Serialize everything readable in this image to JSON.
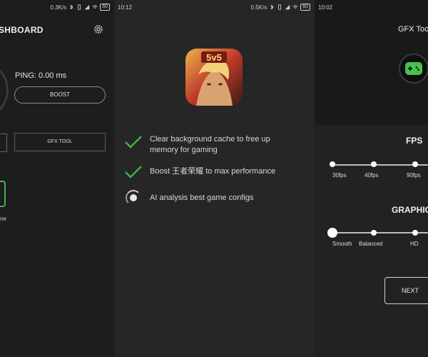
{
  "colors": {
    "accent_green": "#3fb24a",
    "background": "#1c1c1c"
  },
  "panel1": {
    "status": {
      "time": "",
      "speed": "0.3K/s",
      "battery": "60"
    },
    "title": "SHBOARD",
    "settings_icon": "gear-icon",
    "ping": "PING: 0.00 ms",
    "boost_label": "BOOST",
    "gfx_tool_label": "GFX TOOL",
    "partial_text": "ne"
  },
  "panel2": {
    "status": {
      "time": "10:12",
      "speed": "0.5K/s",
      "battery": "60"
    },
    "app_icon_label": "5v5",
    "steps": [
      {
        "text": "Clear background cache to free up memory for gaming",
        "state": "done"
      },
      {
        "text": "Boost 王者荣耀 to max performance",
        "state": "done"
      },
      {
        "text": "AI analysis best game configs",
        "state": "loading"
      }
    ]
  },
  "panel3": {
    "status": {
      "time": "10:02"
    },
    "title": "GFX Tool",
    "gamepad_icon": "gamepad-icon",
    "fps": {
      "title": "FPS",
      "options": [
        "30fps",
        "40fps",
        "90fps"
      ],
      "selected": "30fps"
    },
    "graphics": {
      "title": "GRAPHICS",
      "options": [
        "Smooth",
        "Balanced",
        "HD"
      ],
      "selected": "Smooth"
    },
    "next_label": "NEXT"
  }
}
